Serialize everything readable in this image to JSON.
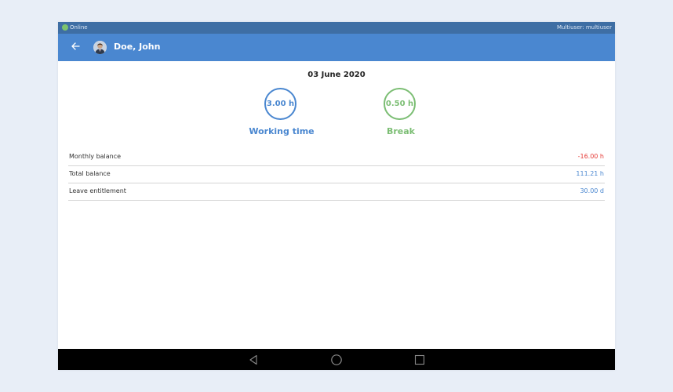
{
  "status_bar": {
    "connection": "Online",
    "user": "Multiuser: multiuser"
  },
  "header": {
    "back_icon": "arrow-left-icon",
    "title": "Doe, John"
  },
  "day": {
    "date": "03 June 2020",
    "working_time": {
      "value": "3.00 h",
      "label": "Working time"
    },
    "break": {
      "value": "0.50 h",
      "label": "Break"
    }
  },
  "balances": [
    {
      "label": "Monthly balance",
      "value": "-16.00 h",
      "color": "#e53935"
    },
    {
      "label": "Total balance",
      "value": "111.21 h",
      "color": "#4a87d0"
    },
    {
      "label": "Leave entitlement",
      "value": "30.00 d",
      "color": "#4a87d0"
    }
  ],
  "colors": {
    "primary": "#4a87d0",
    "status_bar": "#3e6ea4",
    "online": "#7dc36e",
    "break": "#7cbe74",
    "negative": "#e53935"
  },
  "nav_bar": {
    "icons": [
      "triangle-back-icon",
      "circle-home-icon",
      "square-recents-icon"
    ]
  }
}
